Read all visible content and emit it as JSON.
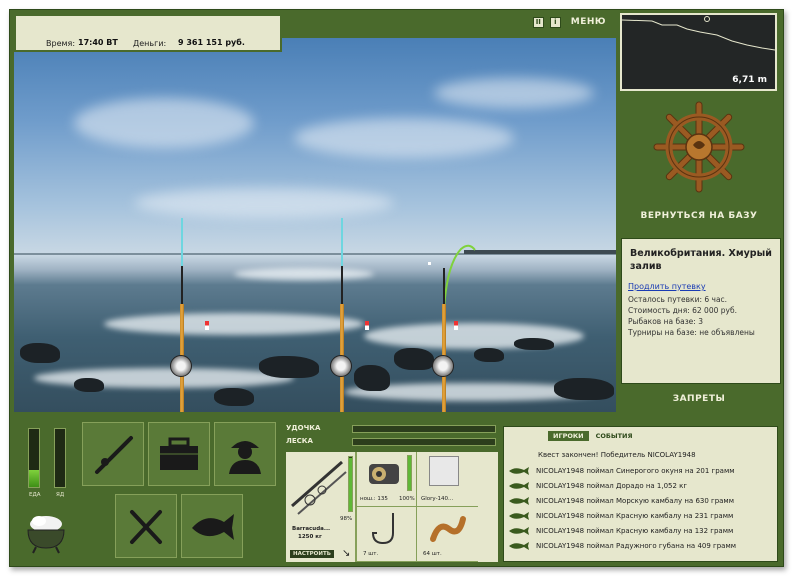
{
  "status": {
    "time_label": "Время:",
    "time_value": "17:40 ВТ",
    "money_label": "Деньги:",
    "money_value": "9 361 151 руб."
  },
  "header": {
    "pause_icon": "pause-icon",
    "info_icon": "info-icon",
    "menu_label": "МЕНЮ"
  },
  "map": {
    "depth": "6,71 m"
  },
  "base": {
    "return_label": "ВЕРНУТЬСЯ НА БАЗУ",
    "icon": "ship-wheel-icon"
  },
  "location": {
    "title": "Великобритания. Хмурый залив",
    "extend_link": "Продлить путевку",
    "lines": [
      "Осталось путевки: 6 час.",
      "Стоимость дня: 62 000 руб.",
      "Рыбаков на базе: 3",
      "Турниры на базе: не объявлены"
    ]
  },
  "bans_label": "ЗАПРЕТЫ",
  "gauges": {
    "food_label": "ЕДА",
    "poison_label": "ЯД",
    "food_level": 0.3,
    "poison_level": 0.0
  },
  "tools": [
    {
      "name": "rods",
      "icon": "fishing-rod-icon"
    },
    {
      "name": "tackle-box",
      "icon": "tackle-box-icon"
    },
    {
      "name": "fisherman",
      "icon": "fisherman-icon"
    },
    {
      "name": "food",
      "icon": "fork-knife-icon"
    },
    {
      "name": "fish-catch",
      "icon": "fish-icon"
    }
  ],
  "rod_numbers": [
    "1",
    "2",
    "3"
  ],
  "tackle": {
    "rod_label": "УДОЧКА",
    "line_label": "ЛЕСКА",
    "rod_name": "Barracuda...",
    "rod_capacity": "1250 кг",
    "rod_percent": "98%",
    "tune_label": "НАСТРОИТЬ",
    "reel_text": "нош.: 135",
    "reel_percent": "100%",
    "lure_name": "Glory-140...",
    "hook_count": "7 шт.",
    "bait_count": "64 шт."
  },
  "chat": {
    "tabs": [
      "ИГРОКИ",
      "СОБЫТИЯ"
    ],
    "events": [
      "Квест закончен! Победитель NICOLAY1948",
      "NICOLAY1948 поймал Синерогого окуня на 201 грамм",
      "NICOLAY1948 поймал Дорадо на 1,052 кг",
      "NICOLAY1948 поймал Морскую камбалу на 630 грамм",
      "NICOLAY1948 поймал Красную камбалу на 231 грамм",
      "NICOLAY1948 поймал Красную камбалу на 132 грамм",
      "NICOLAY1948 поймал Радужного губана на 409 грамм"
    ]
  },
  "colors": {
    "panel_green": "#4a6a2c",
    "panel_cream": "#e6e7cd",
    "link_blue": "#1a3bb3"
  }
}
